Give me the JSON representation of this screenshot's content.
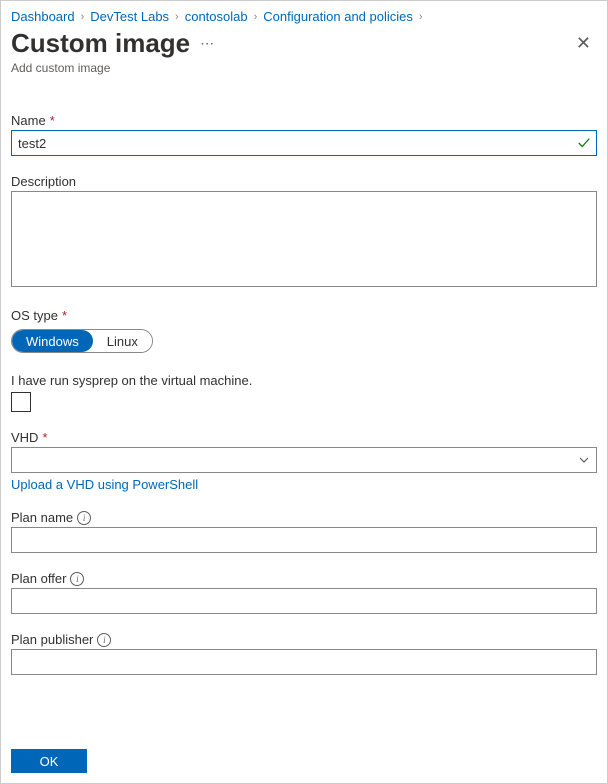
{
  "breadcrumb": {
    "items": [
      "Dashboard",
      "DevTest Labs",
      "contosolab",
      "Configuration and policies"
    ]
  },
  "header": {
    "title": "Custom image",
    "subtitle": "Add custom image"
  },
  "form": {
    "name": {
      "label": "Name",
      "value": "test2"
    },
    "description": {
      "label": "Description",
      "value": ""
    },
    "ostype": {
      "label": "OS type",
      "options": [
        "Windows",
        "Linux"
      ],
      "selected": "Windows"
    },
    "sysprep": {
      "label": "I have run sysprep on the virtual machine.",
      "checked": false
    },
    "vhd": {
      "label": "VHD",
      "upload_link": "Upload a VHD using PowerShell"
    },
    "plan_name": {
      "label": "Plan name",
      "value": ""
    },
    "plan_offer": {
      "label": "Plan offer",
      "value": ""
    },
    "plan_publisher": {
      "label": "Plan publisher",
      "value": ""
    }
  },
  "footer": {
    "ok": "OK"
  }
}
